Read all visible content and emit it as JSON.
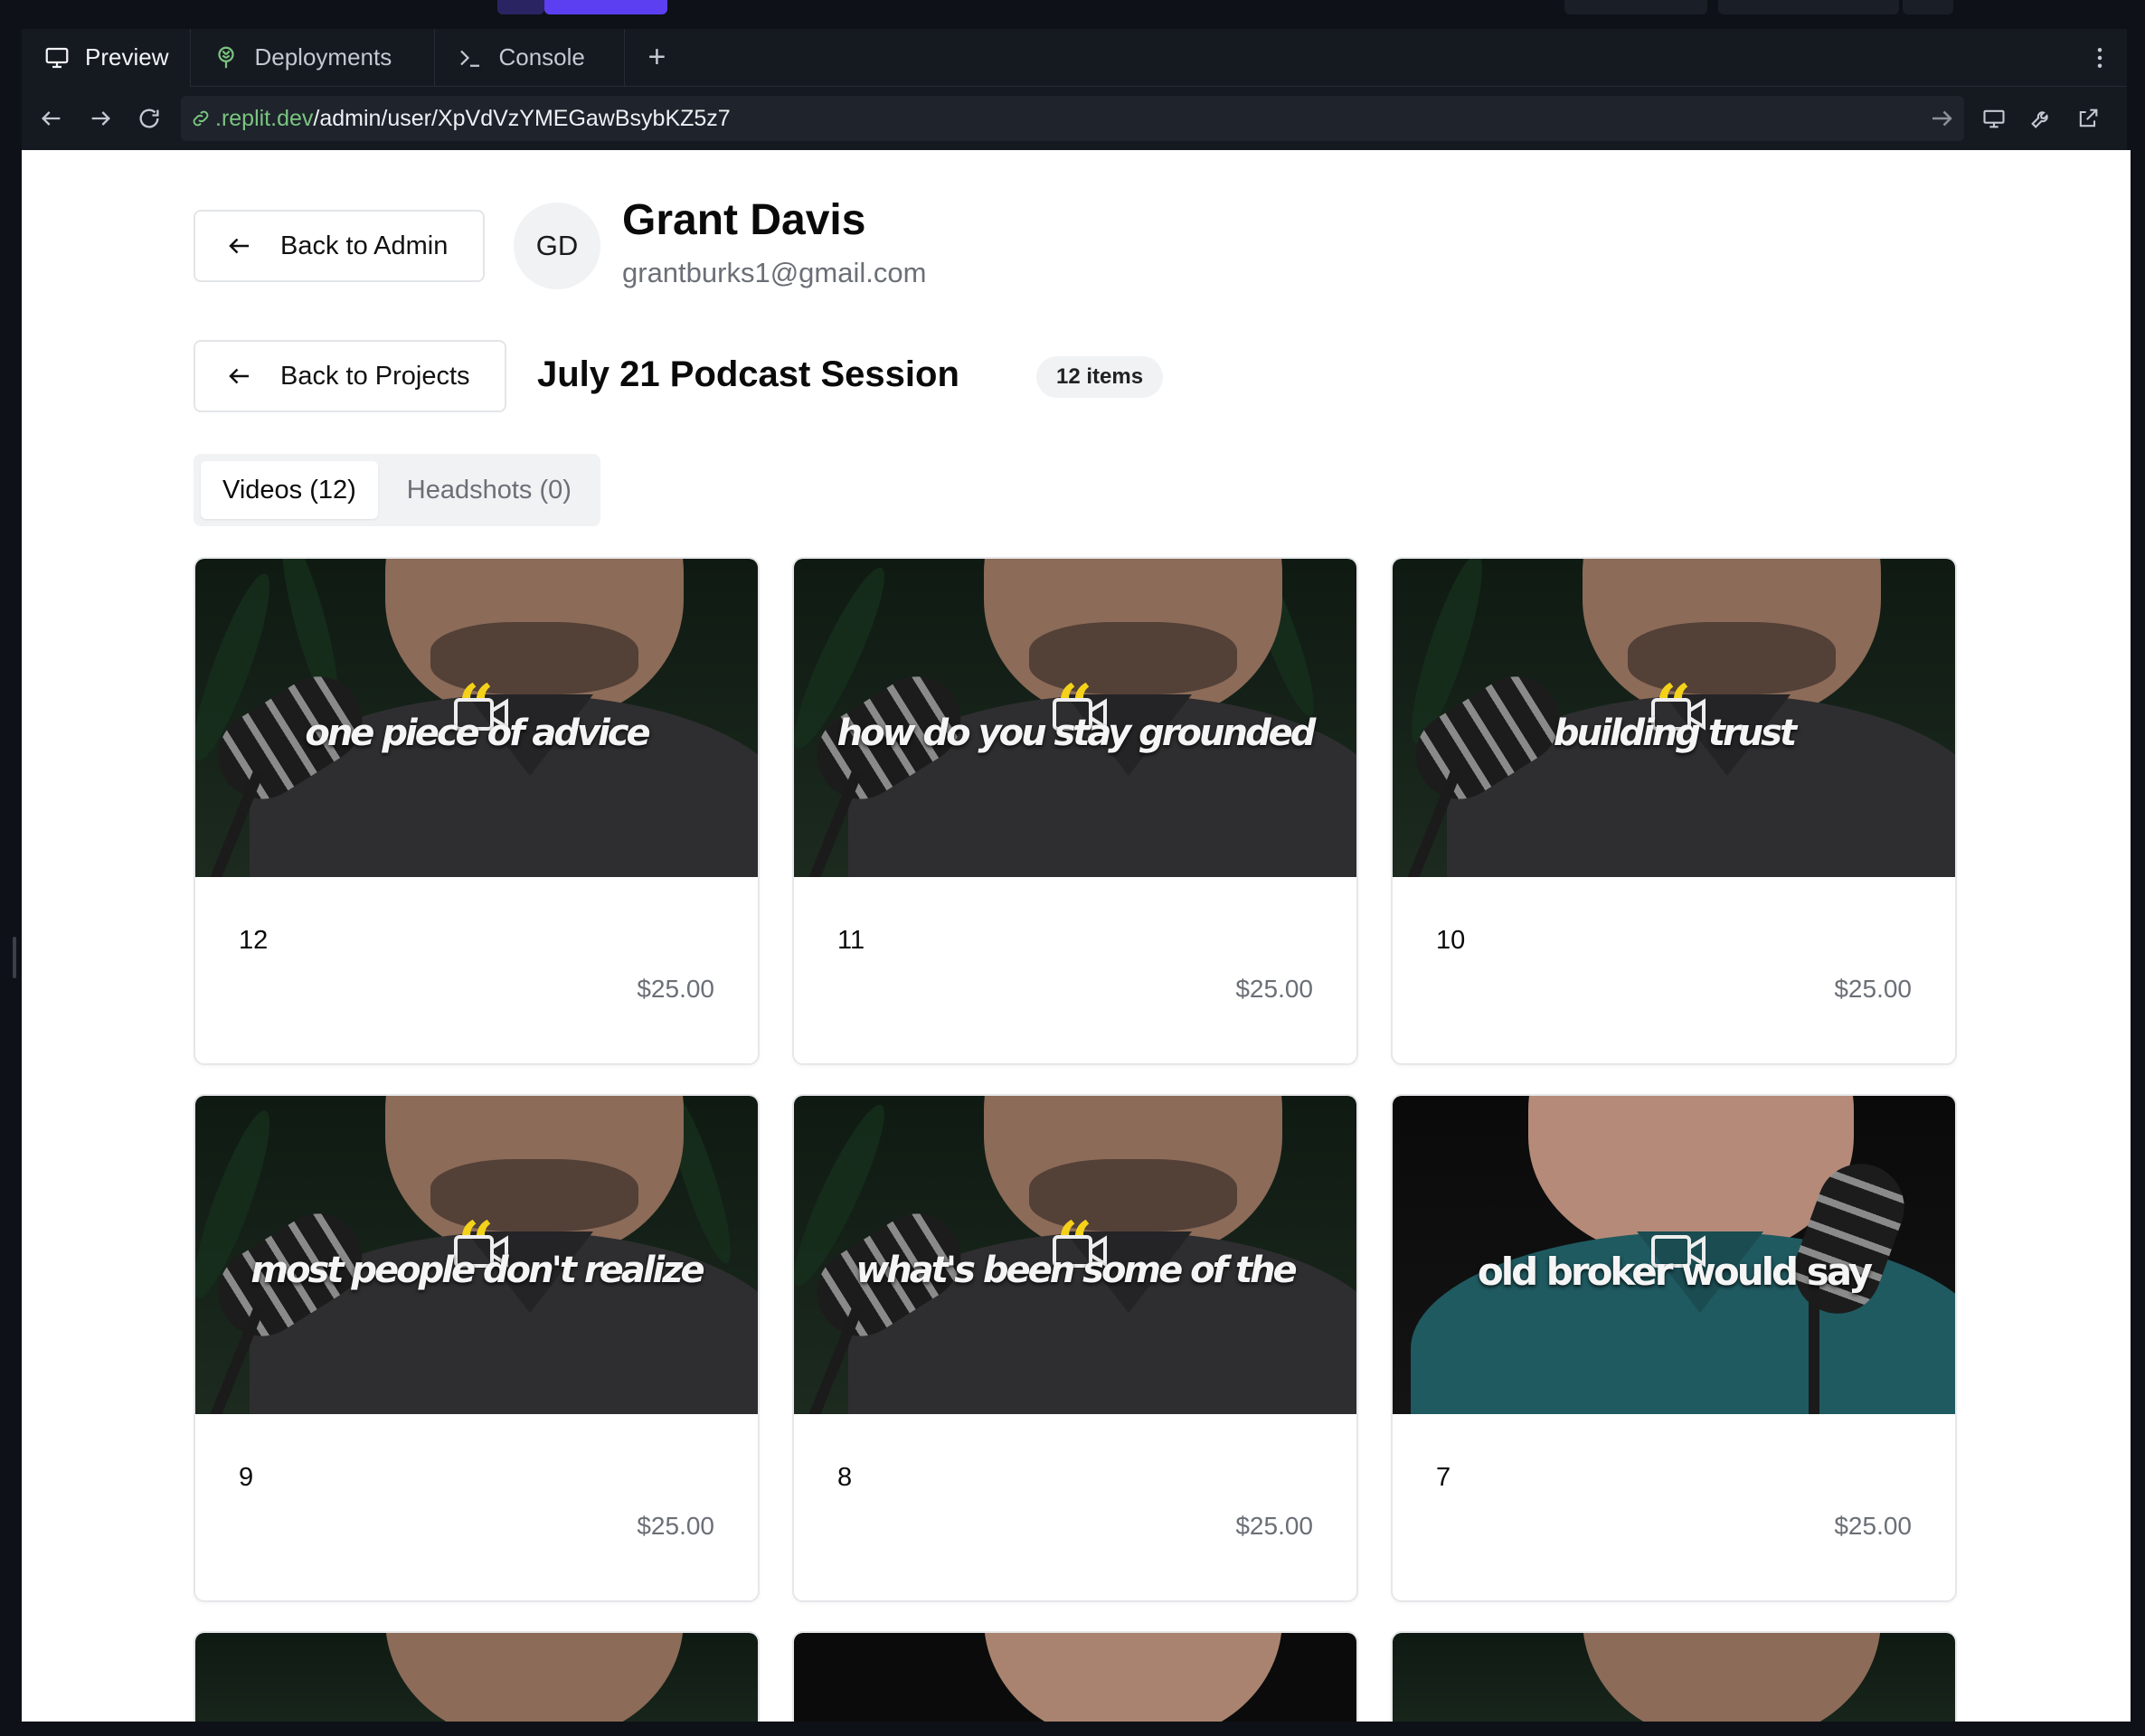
{
  "ide": {
    "tabs": [
      {
        "label": "Preview",
        "icon": "monitor-icon"
      },
      {
        "label": "Deployments",
        "icon": "deploy-tree-icon"
      },
      {
        "label": "Console",
        "icon": "terminal-icon"
      }
    ],
    "add_tab": "+",
    "url": {
      "host": ".replit.dev",
      "path": "/admin/user/XpVdVzYMEGawBsybKZ5z7"
    }
  },
  "page": {
    "back_admin_label": "Back to Admin",
    "user": {
      "initials": "GD",
      "name": "Grant Davis",
      "email": "grantburks1@gmail.com"
    },
    "back_projects_label": "Back to Projects",
    "project_title": "July 21 Podcast Session",
    "items_badge": "12 items",
    "media_tabs": [
      {
        "label": "Videos (12)",
        "active": true
      },
      {
        "label": "Headshots (0)",
        "active": false
      }
    ],
    "videos": [
      {
        "number": "12",
        "price": "$25.00",
        "caption": "one piece of advice"
      },
      {
        "number": "11",
        "price": "$25.00",
        "caption": "how do you stay grounded"
      },
      {
        "number": "10",
        "price": "$25.00",
        "caption": "building trust"
      },
      {
        "number": "9",
        "price": "$25.00",
        "caption": "most people don't realize"
      },
      {
        "number": "8",
        "price": "$25.00",
        "caption": "what's been some of the"
      },
      {
        "number": "7",
        "price": "$25.00",
        "caption": "old broker would say"
      }
    ]
  },
  "colors": {
    "url_host": "#7ac47f",
    "accent_purple": "#5b3ff0",
    "quote_yellow": "#f4d21a"
  }
}
